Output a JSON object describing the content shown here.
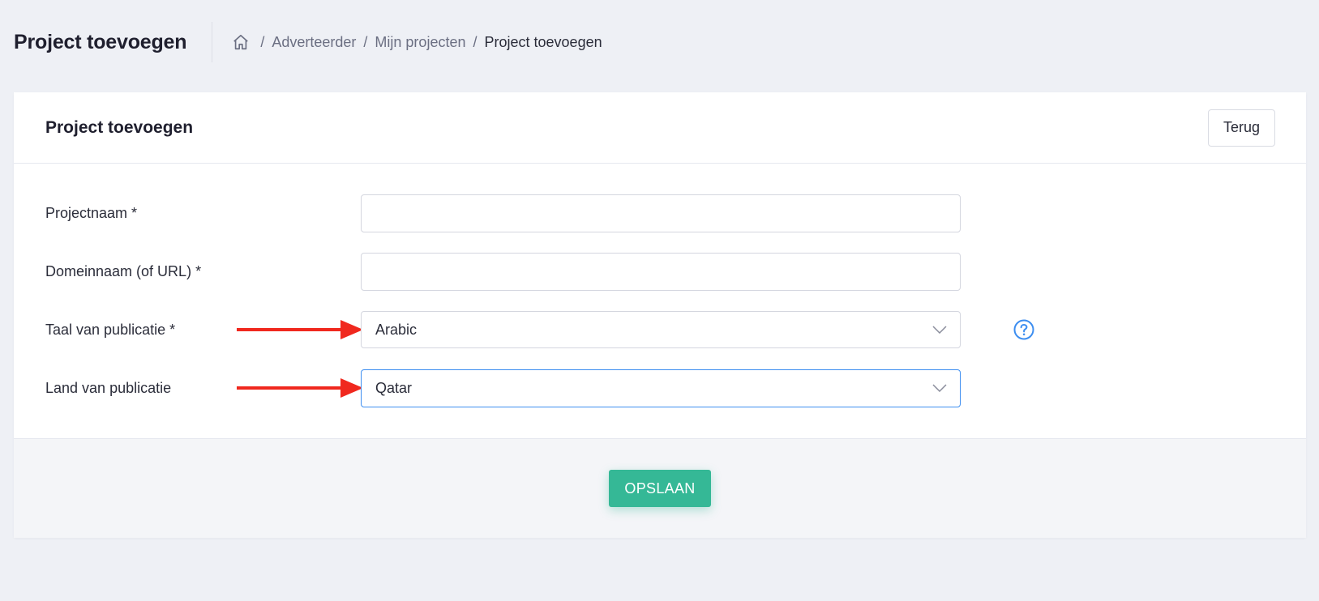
{
  "subheader": {
    "title": "Project toevoegen",
    "breadcrumb": {
      "home_icon": "home-icon",
      "separator": "/",
      "items": [
        "Adverteerder",
        "Mijn projecten",
        "Project toevoegen"
      ]
    }
  },
  "card": {
    "title": "Project toevoegen",
    "back_label": "Terug"
  },
  "form": {
    "project_name": {
      "label": "Projectnaam *",
      "value": ""
    },
    "domain": {
      "label": "Domeinnaam (of URL) *",
      "value": ""
    },
    "language": {
      "label": "Taal van publicatie *",
      "selected": "Arabic",
      "help_icon": "help-icon"
    },
    "country": {
      "label": "Land van publicatie",
      "selected": "Qatar"
    }
  },
  "footer": {
    "save_label": "OPSLAAN"
  },
  "colors": {
    "accent": "#35b896",
    "focus": "#3d8ef0",
    "annotation_arrow": "#f0281e",
    "background": "#eef0f5"
  }
}
